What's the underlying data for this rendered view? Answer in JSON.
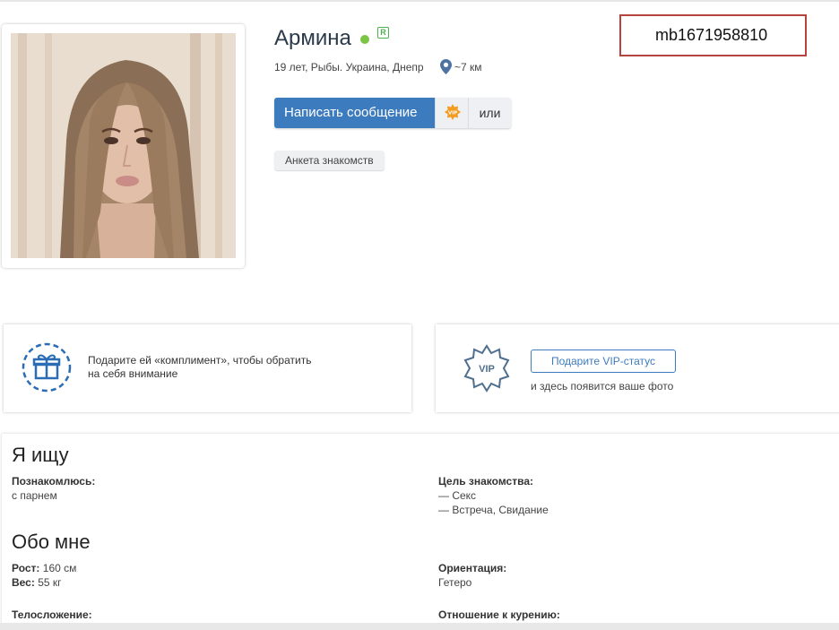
{
  "profile": {
    "name": "Армина",
    "badge": "R",
    "location": "19 лет, Рыбы. Украина, Днепр",
    "distance": "~7 км",
    "id_code": "mb1671958810",
    "online_color": "#7cc444"
  },
  "actions": {
    "message_label": "Написать сообщение",
    "vip_icon": "vip-burst-icon",
    "or_label": "или",
    "tag_label": "Анкета знакомств"
  },
  "promo": {
    "gift_text_line1": "Подарите ей «комплимент», чтобы обратить",
    "gift_text_line2": "на себя внимание",
    "vip_badge_text": "VIP",
    "vip_button_label": "Подарите VIP-статус",
    "vip_caption": "и здесь появится ваше фото"
  },
  "seeking": {
    "title": "Я ищу",
    "meet_label": "Познакомлюсь:",
    "meet_value": "с парнем",
    "goal_label": "Цель знакомства:",
    "goal_values": [
      "— Секс",
      "— Встреча, Свидание"
    ]
  },
  "about": {
    "title": "Обо мне",
    "height_label": "Рост:",
    "height_value": "160 см",
    "weight_label": "Вес:",
    "weight_value": "55 кг",
    "orientation_label": "Ориентация:",
    "orientation_value": "Гетеро",
    "body_label": "Телосложение:",
    "smoking_label": "Отношение к курению:"
  },
  "colors": {
    "accent": "#3d7bbf",
    "id_border": "#b5443e"
  }
}
